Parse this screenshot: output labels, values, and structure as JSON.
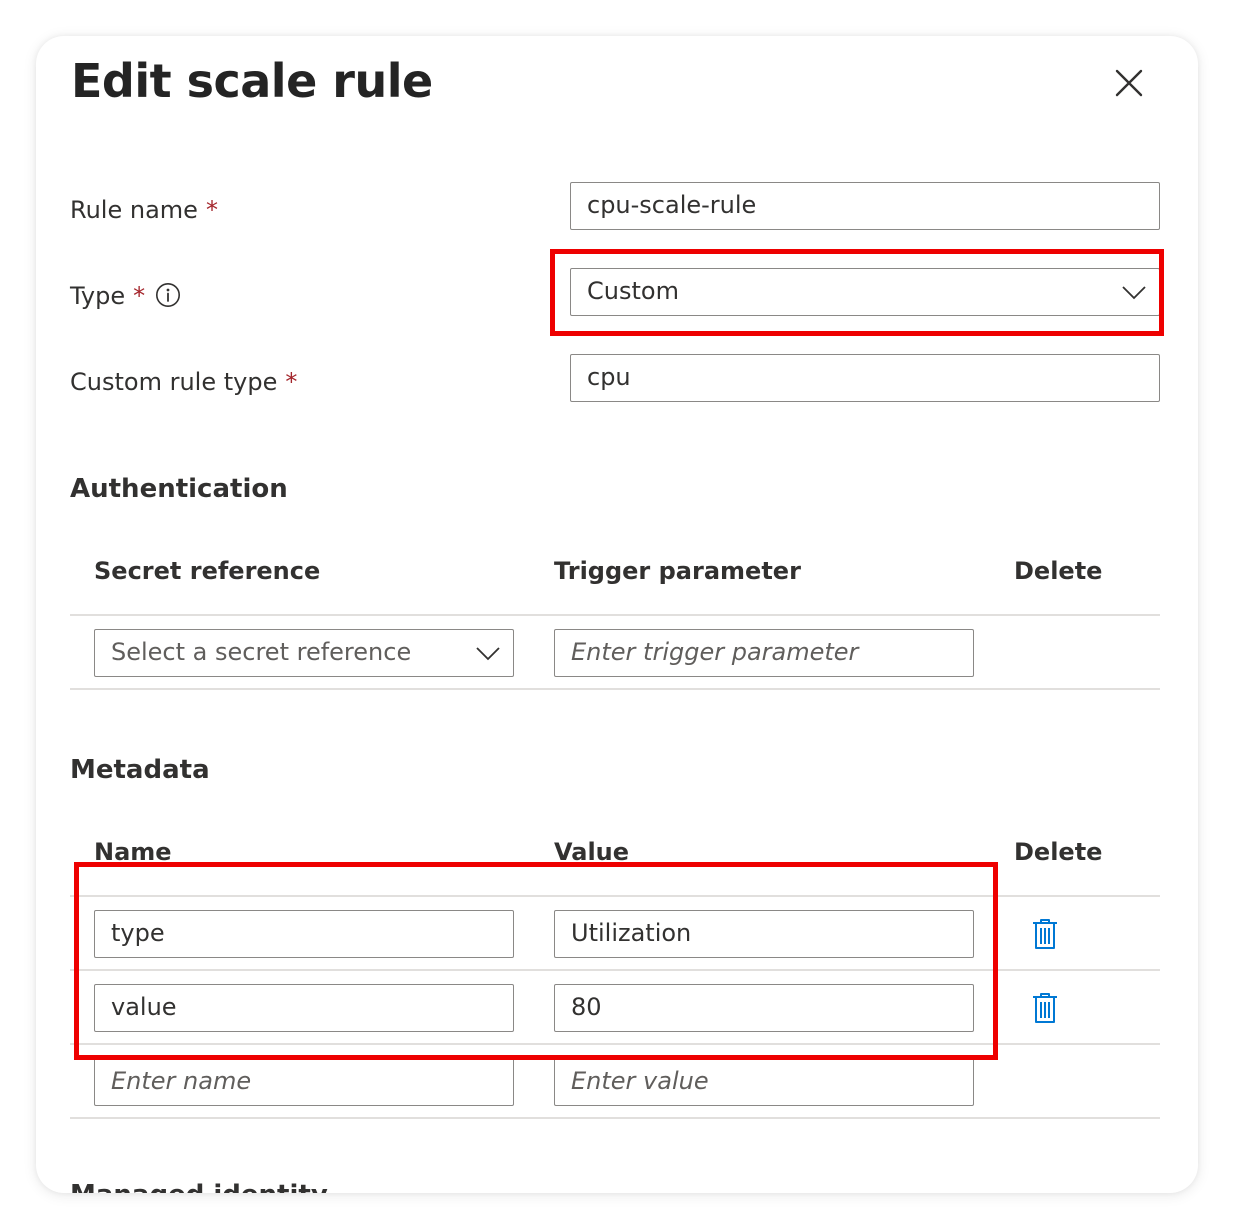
{
  "panel": {
    "title": "Edit scale rule",
    "close_icon": "close-icon"
  },
  "form": {
    "rule_name": {
      "label": "Rule name",
      "required": "*",
      "value": "cpu-scale-rule"
    },
    "type": {
      "label": "Type",
      "required": "*",
      "value": "Custom",
      "info_icon": "info-icon"
    },
    "custom_rule_type": {
      "label": "Custom rule type",
      "required": "*",
      "value": "cpu"
    }
  },
  "authentication": {
    "title": "Authentication",
    "columns": [
      "Secret reference",
      "Trigger parameter",
      "Delete"
    ],
    "row": {
      "secret_placeholder": "Select a secret reference",
      "trigger_placeholder": "Enter trigger parameter"
    }
  },
  "metadata": {
    "title": "Metadata",
    "columns": [
      "Name",
      "Value",
      "Delete"
    ],
    "rows": [
      {
        "name": "type",
        "value": "Utilization"
      },
      {
        "name": "value",
        "value": "80"
      }
    ],
    "new_row": {
      "name_placeholder": "Enter name",
      "value_placeholder": "Enter value"
    }
  },
  "next_section_partial": "Managed identity",
  "colors": {
    "highlight": "#ee0000",
    "accent": "#0078d4",
    "required": "#a4262c"
  }
}
